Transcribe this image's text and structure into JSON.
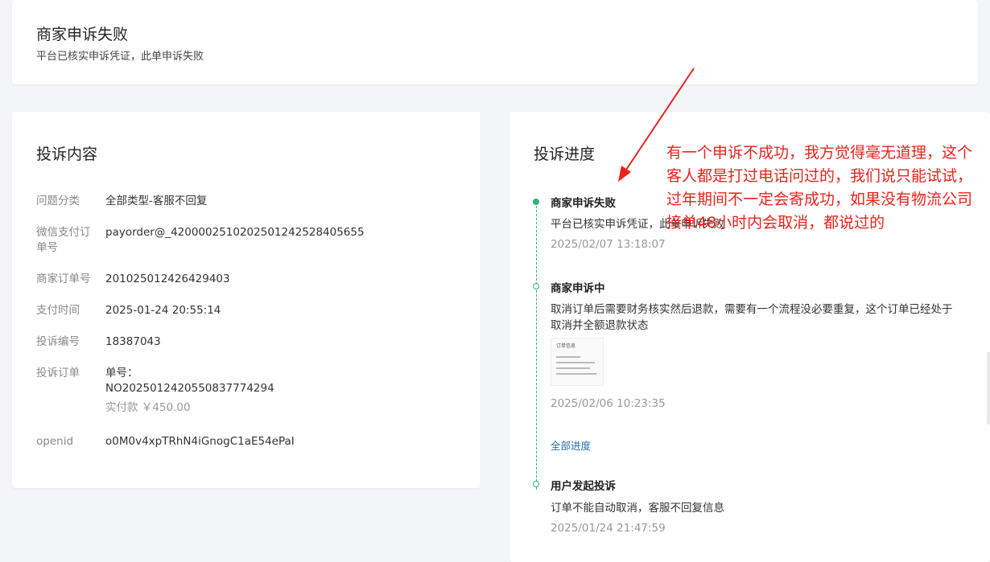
{
  "status": {
    "title": "商家申诉失败",
    "desc": "平台已核实申诉凭证，此单申诉失败"
  },
  "complaint": {
    "title": "投诉内容",
    "rows": {
      "category": {
        "label": "问题分类",
        "value": "全部类型-客服不回复"
      },
      "wechat_order": {
        "label": "微信支付订单号",
        "value": "payorder@_4200002510202501242528405655"
      },
      "merchant_order": {
        "label": "商家订单号",
        "value": "201025012426429403"
      },
      "pay_time": {
        "label": "支付时间",
        "value": "2025-01-24 20:55:14"
      },
      "complaint_no": {
        "label": "投诉编号",
        "value": "18387043"
      },
      "complaint_order": {
        "label": "投诉订单",
        "value_prefix": "单号：",
        "value": "NO2025012420550837774294",
        "paid": "实付款 ￥450.00"
      },
      "openid": {
        "label": "openid",
        "value": "o0M0v4xpTRhN4iGnogC1aE54ePaI"
      }
    }
  },
  "progress": {
    "title": "投诉进度",
    "items": [
      {
        "title": "商家申诉失败",
        "desc": "平台已核实申诉凭证，此单申诉失败",
        "time": "2025/02/07 13:18:07"
      },
      {
        "title": "商家申诉中",
        "desc": "取消订单后需要财务核实然后退款，需要有一个流程没必要重复，这个订单已经处于取消并全额退款状态",
        "time": "2025/02/06 10:23:35",
        "thumb_label": "订单信息"
      },
      {
        "title": "用户发起投诉",
        "desc": "订单不能自动取消，客服不回复信息",
        "time": "2025/01/24 21:47:59"
      }
    ],
    "all_progress_link": "全部进度"
  },
  "annotation": {
    "text": "有一个申诉不成功，我方觉得毫无道理，这个客人都是打过电话问过的，我们说只能试试，过年期间不一定会寄成功，如果没有物流公司接单48小时内会取消，都说过的",
    "color": "#e8231b"
  },
  "colors": {
    "accent_green": "#2bb673",
    "link_blue": "#2a6ea8",
    "background": "#f4f5f7"
  }
}
